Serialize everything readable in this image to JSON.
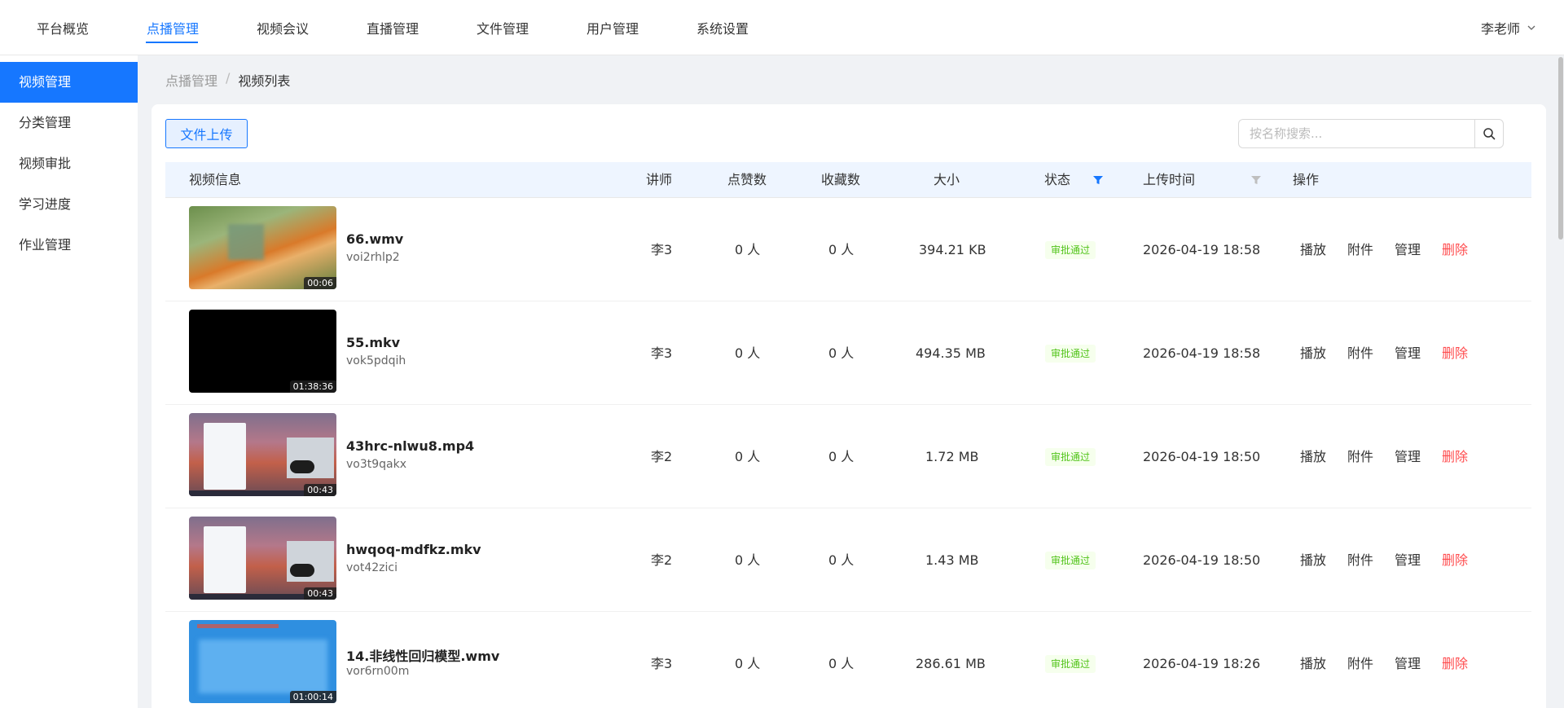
{
  "topnav": {
    "items": [
      {
        "label": "平台概览"
      },
      {
        "label": "点播管理",
        "active": true
      },
      {
        "label": "视频会议"
      },
      {
        "label": "直播管理"
      },
      {
        "label": "文件管理"
      },
      {
        "label": "用户管理"
      },
      {
        "label": "系统设置"
      }
    ],
    "user": "李老师"
  },
  "sidebar": {
    "items": [
      {
        "label": "视频管理",
        "active": true
      },
      {
        "label": "分类管理"
      },
      {
        "label": "视频审批"
      },
      {
        "label": "学习进度"
      },
      {
        "label": "作业管理"
      }
    ]
  },
  "breadcrumb": {
    "parent": "点播管理",
    "separator": "/",
    "current": "视频列表"
  },
  "toolbar": {
    "upload_label": "文件上传",
    "search_placeholder": "按名称搜索..."
  },
  "table": {
    "headers": {
      "info": "视频信息",
      "teacher": "讲师",
      "likes": "点赞数",
      "favorites": "收藏数",
      "size": "大小",
      "status": "状态",
      "upload_time": "上传时间",
      "actions": "操作"
    },
    "actions": {
      "play": "播放",
      "attachment": "附件",
      "manage": "管理",
      "delete": "删除"
    },
    "rows": [
      {
        "name": "66.wmv",
        "id": "voi2rhlp2",
        "duration": "00:06",
        "teacher": "李3",
        "likes": "0 人",
        "favorites": "0 人",
        "size": "394.21 KB",
        "status": "审批通过",
        "time": "2026-04-19 18:58"
      },
      {
        "name": "55.mkv",
        "id": "vok5pdqih",
        "duration": "01:38:36",
        "teacher": "李3",
        "likes": "0 人",
        "favorites": "0 人",
        "size": "494.35 MB",
        "status": "审批通过",
        "time": "2026-04-19 18:58"
      },
      {
        "name": "43hrc-nlwu8.mp4",
        "id": "vo3t9qakx",
        "duration": "00:43",
        "teacher": "李2",
        "likes": "0 人",
        "favorites": "0 人",
        "size": "1.72 MB",
        "status": "审批通过",
        "time": "2026-04-19 18:50"
      },
      {
        "name": "hwqoq-mdfkz.mkv",
        "id": "vot42zici",
        "duration": "00:43",
        "teacher": "李2",
        "likes": "0 人",
        "favorites": "0 人",
        "size": "1.43 MB",
        "status": "审批通过",
        "time": "2026-04-19 18:50"
      },
      {
        "name": "14.非线性回归模型.wmv",
        "id": "vor6rn00m",
        "duration": "01:00:14",
        "teacher": "李3",
        "likes": "0 人",
        "favorites": "0 人",
        "size": "286.61 MB",
        "status": "审批通过",
        "time": "2026-04-19 18:26"
      }
    ]
  },
  "colors": {
    "accent": "#1677ff",
    "danger": "#ff4d4f",
    "success": "#52c41a"
  }
}
